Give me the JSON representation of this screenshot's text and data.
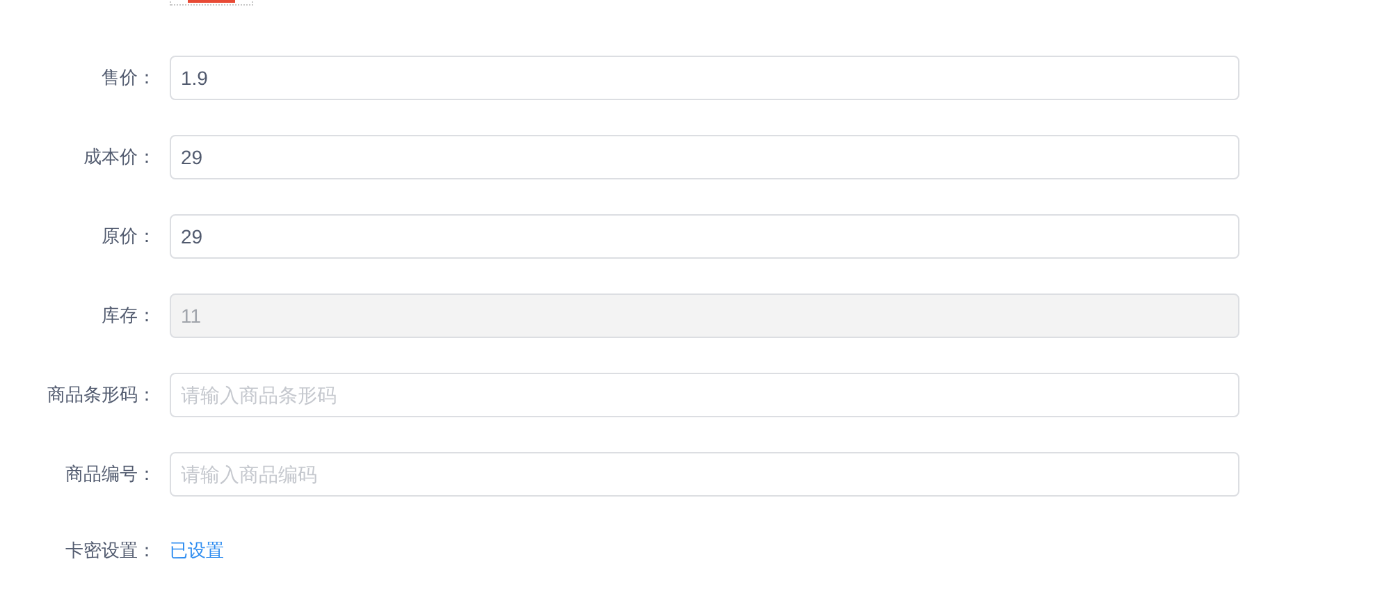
{
  "fields": [
    {
      "kind": "input",
      "label": "售价：",
      "value": "1.9",
      "disabled": false
    },
    {
      "kind": "input",
      "label": "成本价：",
      "value": "29",
      "disabled": false
    },
    {
      "kind": "input",
      "label": "原价：",
      "value": "29",
      "disabled": false
    },
    {
      "kind": "input",
      "label": "库存：",
      "value": "11",
      "disabled": true
    },
    {
      "kind": "input",
      "label": "商品条形码：",
      "placeholder": "请输入商品条形码",
      "disabled": false
    },
    {
      "kind": "input",
      "label": "商品编号：",
      "placeholder": "请输入商品编码",
      "disabled": false
    },
    {
      "kind": "link",
      "label": "卡密设置：",
      "value": "已设置"
    }
  ]
}
